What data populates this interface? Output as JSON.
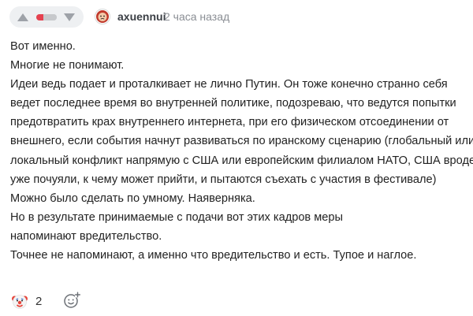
{
  "comment": {
    "author": {
      "username": "axuennui",
      "avatar_icon": "sad-face-avatar-icon"
    },
    "timestamp": "2 часа назад",
    "rating": {
      "negative_share": 0.35,
      "colors": {
        "negative": "#e5414f",
        "neutral": "#c7c9cc"
      }
    },
    "body_lines": [
      "Вот именно.",
      "Многие не понимают.",
      "Идеи ведь подает и проталкивает не лично Путин. Он тоже конечно странно себя",
      "ведет последнее время во внутренней политике, подозреваю, что ведутся попытки",
      "предотвратить крах внутреннего интернета, при его физическом отсоединении от",
      "внешнего, если события начнут развиваться по иранскому сценарию (глобальный или",
      "локальный конфликт напрямую с США или европейским филиалом НАТО, США вроде",
      "уже почуяли, к чему может прийти, и пытаются съехать с участия в фестивале)",
      "",
      "Можно было сделать по умному. Наяверняка.",
      "Но в результате принимаемые с подачи вот этих кадров меры",
      "напоминают вредительство.",
      "Точнее не напоминают, а именно что вредительство и есть. Тупое и наглое."
    ],
    "reactions": [
      {
        "icon": "clown-face-icon",
        "count": "2"
      }
    ],
    "add_reaction_icon": "add-reaction-smiley-icon"
  }
}
